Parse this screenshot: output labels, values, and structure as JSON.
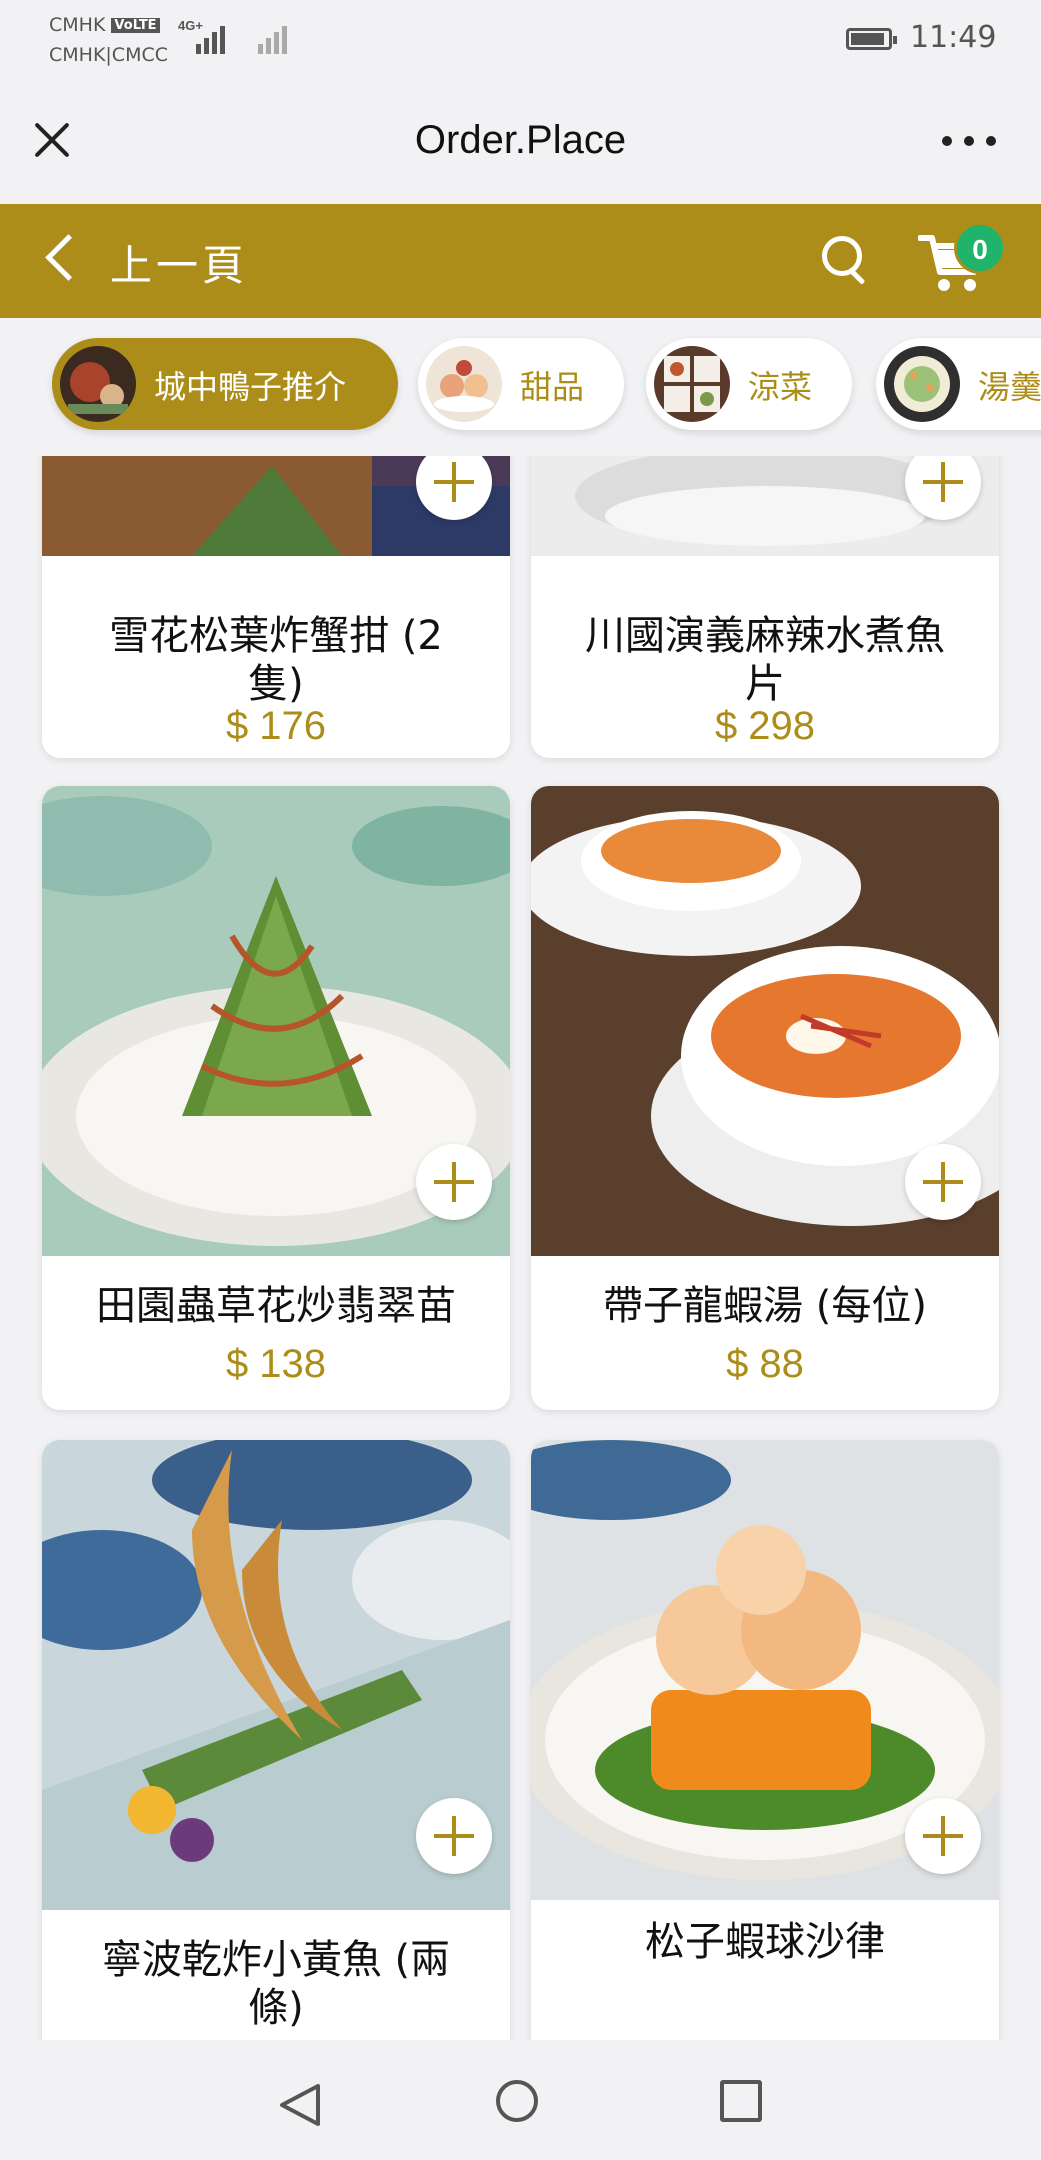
{
  "status_bar": {
    "carrier_1": "CMHK",
    "volte": "VoLTE",
    "carrier_2": "CMHK|CMCC",
    "network": "4G+",
    "time": "11:49"
  },
  "title_bar": {
    "title": "Order.Place",
    "close_icon": "close-icon",
    "more_icon": "more-icon"
  },
  "nav": {
    "back_label": "上一頁",
    "cart_count": "0",
    "accent": "#ad8d1a",
    "badge_color": "#1fb36b"
  },
  "categories": [
    {
      "label": "城中鴨子推介",
      "active": true
    },
    {
      "label": "甜品",
      "active": false
    },
    {
      "label": "涼菜",
      "active": false
    },
    {
      "label": "湯羹",
      "active": false
    }
  ],
  "menu": [
    {
      "name_line1": "雪花松葉炸蟹拑 (2",
      "name_line2": "隻)",
      "price": "$ 176"
    },
    {
      "name_line1": "川國演義麻辣水煮魚",
      "name_line2": "片",
      "price": "$ 298"
    },
    {
      "name_line1": "田園蟲草花炒翡翠苗",
      "name_line2": "",
      "price": "$ 138"
    },
    {
      "name_line1": "帶子龍蝦湯 (每位)",
      "name_line2": "",
      "price": "$ 88"
    },
    {
      "name_line1": "寧波乾炸小黃魚 (兩",
      "name_line2": "條)",
      "price": ""
    },
    {
      "name_line1": "松子蝦球沙律",
      "name_line2": "",
      "price": ""
    }
  ]
}
